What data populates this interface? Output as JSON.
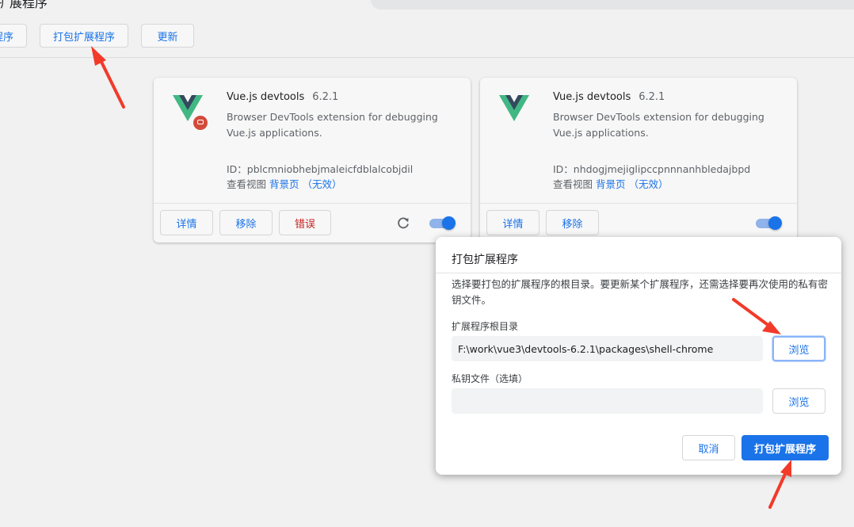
{
  "page": {
    "title": "扩展程序",
    "background": "#f1f1f1",
    "accent": "#1a73e8"
  },
  "toolbar": {
    "load_label": "程序",
    "pack_label": "打包扩展程序",
    "update_label": "更新"
  },
  "cards": [
    {
      "name": "Vue.js devtools",
      "version": "6.2.1",
      "description": "Browser DevTools extension for debugging Vue.js applications.",
      "id_text": "ID：pblcmniobhebjmaleicfdblalcobjdil",
      "views_label": "查看视图",
      "views_link": "背景页 （无效）",
      "details_label": "详情",
      "remove_label": "移除",
      "errors_label": "错误",
      "has_error_badge": true,
      "enabled": true
    },
    {
      "name": "Vue.js devtools",
      "version": "6.2.1",
      "description": "Browser DevTools extension for debugging Vue.js applications.",
      "id_text": "ID：nhdogjmejiglipccpnnnanhbledajbpd",
      "views_label": "查看视图",
      "views_link": "背景页 （无效）",
      "details_label": "详情",
      "remove_label": "移除",
      "enabled": true
    }
  ],
  "dialog": {
    "title": "打包扩展程序",
    "description": "选择要打包的扩展程序的根目录。要更新某个扩展程序，还需选择要再次使用的私有密钥文件。",
    "root_label": "扩展程序根目录",
    "root_value": "F:\\work\\vue3\\devtools-6.2.1\\packages\\shell-chrome",
    "browse_label": "浏览",
    "key_label": "私钥文件（选填）",
    "key_value": "",
    "cancel_label": "取消",
    "pack_label": "打包扩展程序"
  },
  "colors": {
    "error": "#c5221f",
    "arrow": "#f23a2a",
    "vue_green": "#41b883",
    "vue_dark": "#34495e"
  }
}
